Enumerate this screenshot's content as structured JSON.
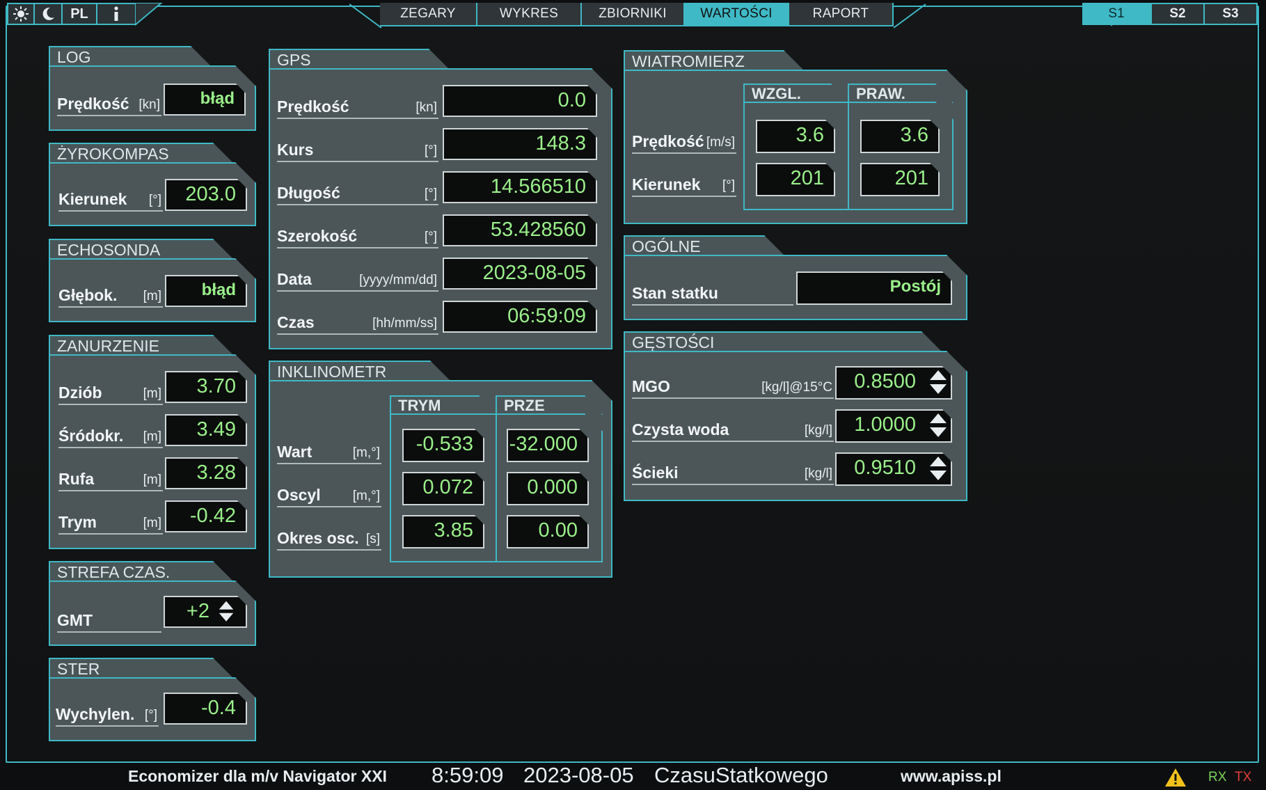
{
  "topbar": {
    "sun_icon": "sun-icon",
    "moon_icon": "moon-icon",
    "lang": "PL",
    "info_icon": "info-icon",
    "tabs": [
      "ZEGARY",
      "WYKRES",
      "ZBIORNIKI",
      "WARTOŚCI",
      "RAPORT"
    ],
    "active_tab": "WARTOŚCI",
    "screens": [
      "S1",
      "S2",
      "S3"
    ],
    "active_screen": "S1"
  },
  "log": {
    "title": "LOG",
    "label": "Prędkość",
    "unit": "[kn]",
    "value": "błąd"
  },
  "gyro": {
    "title": "ŻYROKOMPAS",
    "label": "Kierunek",
    "unit": "[°]",
    "value": "203.0"
  },
  "echo": {
    "title": "ECHOSONDA",
    "label": "Głębok.",
    "unit": "[m]",
    "value": "błąd"
  },
  "draft": {
    "title": "ZANURZENIE",
    "rows": [
      {
        "label": "Dziób",
        "unit": "[m]",
        "value": "3.70"
      },
      {
        "label": "Śródokr.",
        "unit": "[m]",
        "value": "3.49"
      },
      {
        "label": "Rufa",
        "unit": "[m]",
        "value": "3.28"
      },
      {
        "label": "Trym",
        "unit": "[m]",
        "value": "-0.42"
      }
    ]
  },
  "timezone": {
    "title": "STREFA CZAS.",
    "label": "GMT",
    "value": "+2"
  },
  "rudder": {
    "title": "STER",
    "label": "Wychylen.",
    "unit": "[°]",
    "value": "-0.4"
  },
  "gps": {
    "title": "GPS",
    "rows": [
      {
        "label": "Prędkość",
        "unit": "[kn]",
        "value": "0.0"
      },
      {
        "label": "Kurs",
        "unit": "[°]",
        "value": "148.3"
      },
      {
        "label": "Długość",
        "unit": "[°]",
        "value": "14.566510"
      },
      {
        "label": "Szerokość",
        "unit": "[°]",
        "value": "53.428560"
      },
      {
        "label": "Data",
        "unit": "[yyyy/mm/dd]",
        "value": "2023-08-05"
      },
      {
        "label": "Czas",
        "unit": "[hh/mm/ss]",
        "value": "06:59:09"
      }
    ]
  },
  "incl": {
    "title": "INKLINOMETR",
    "col1": "TRYM",
    "col2": "PRZE",
    "rows": [
      {
        "label": "Wart",
        "unit": "[m,°]",
        "trym": "-0.533",
        "prze": "-32.000"
      },
      {
        "label": "Oscyl",
        "unit": "[m,°]",
        "trym": "0.072",
        "prze": "0.000"
      },
      {
        "label": "Okres osc.",
        "unit": "[s]",
        "trym": "3.85",
        "prze": "0.00"
      }
    ]
  },
  "wind": {
    "title": "WIATROMIERZ",
    "col1": "WZGL.",
    "col2": "PRAW.",
    "rows": [
      {
        "label": "Prędkość",
        "unit": "[m/s]",
        "wzgl": "3.6",
        "praw": "3.6"
      },
      {
        "label": "Kierunek",
        "unit": "[°]",
        "wzgl": "201",
        "praw": "201"
      }
    ]
  },
  "general": {
    "title": "OGÓLNE",
    "label": "Stan statku",
    "value": "Postój"
  },
  "density": {
    "title": "GĘSTOŚCI",
    "rows": [
      {
        "label": "MGO",
        "unit": "[kg/l]@15°C",
        "value": "0.8500"
      },
      {
        "label": "Czysta woda",
        "unit": "[kg/l]",
        "value": "1.0000"
      },
      {
        "label": "Ścieki",
        "unit": "[kg/l]",
        "value": "0.9510"
      }
    ]
  },
  "status": {
    "app": "Economizer dla m/v Navigator XXI",
    "time": "8:59:09",
    "date": "2023-08-05",
    "mode": "CzasuStatkowego",
    "site": "www.apiss.pl",
    "warning_icon": "warning-icon",
    "rx": "RX",
    "tx": "TX"
  },
  "colors": {
    "accent": "#3fb9c6",
    "value_green": "#9af08a",
    "panel": "#4c5659",
    "background": "#0d0e10"
  }
}
